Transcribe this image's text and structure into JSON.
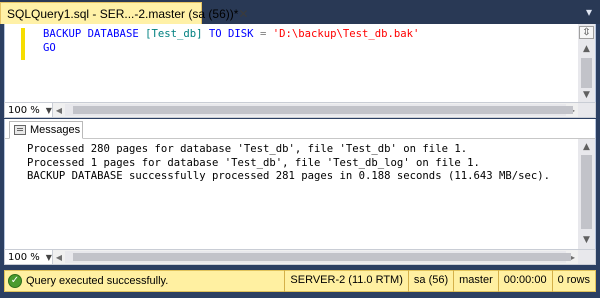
{
  "tab": {
    "title": "SQLQuery1.sql - SER...-2.master (sa (56))*",
    "close_glyph": "✕"
  },
  "editor": {
    "line1": {
      "kw1": "BACKUP",
      "kw2": "DATABASE",
      "ident": "[Test_db]",
      "kw3": "TO",
      "kw4": "DISK",
      "op": "=",
      "str": "'D:\\backup\\Test_db.bak'"
    },
    "line2": "GO",
    "zoom": "100 %"
  },
  "results": {
    "tab_label": "Messages",
    "lines": [
      "Processed 280 pages for database 'Test_db', file 'Test_db' on file 1.",
      "Processed 1 pages for database 'Test_db', file 'Test_db_log' on file 1.",
      "BACKUP DATABASE successfully processed 281 pages in 0.188 seconds (11.643 MB/sec)."
    ],
    "zoom": "100 %"
  },
  "status": {
    "message": "Query executed successfully.",
    "server": "SERVER-2 (11.0 RTM)",
    "user": "sa (56)",
    "database": "master",
    "elapsed": "00:00:00",
    "rows": "0 rows"
  },
  "icons": {
    "close": "close-icon",
    "dropdown": "chevron-down-icon",
    "success": "checkmark-circle-icon",
    "messages": "messages-icon",
    "split": "split-editor-icon"
  },
  "colors": {
    "keyword": "#0000ff",
    "identifier": "#008080",
    "string": "#ff0000",
    "status_bar": "#fff0a1",
    "active_tab": "#fff1a7",
    "chrome": "#293955"
  }
}
